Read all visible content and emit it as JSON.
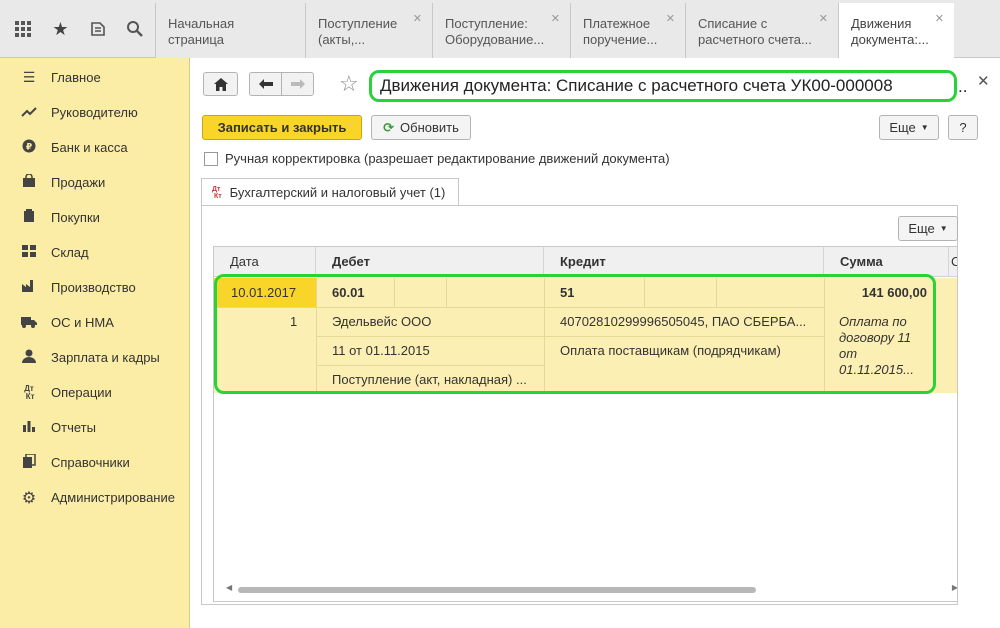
{
  "tabs": [
    {
      "label": "Начальная страница"
    },
    {
      "label": "Поступление (акты,..."
    },
    {
      "label": "Поступление: Оборудование..."
    },
    {
      "label": "Платежное поручение..."
    },
    {
      "label": "Списание с расчетного счета..."
    },
    {
      "label": "Движения документа:..."
    }
  ],
  "sidebar": {
    "items": [
      {
        "label": "Главное",
        "icon": "menu-lines-icon"
      },
      {
        "label": "Руководителю",
        "icon": "trend-chart-icon"
      },
      {
        "label": "Банк и касса",
        "icon": "ruble-coin-icon"
      },
      {
        "label": "Продажи",
        "icon": "shopping-bag-icon"
      },
      {
        "label": "Покупки",
        "icon": "cart-icon"
      },
      {
        "label": "Склад",
        "icon": "warehouse-icon"
      },
      {
        "label": "Производство",
        "icon": "factory-icon"
      },
      {
        "label": "ОС и НМА",
        "icon": "truck-icon"
      },
      {
        "label": "Зарплата и кадры",
        "icon": "person-icon"
      },
      {
        "label": "Операции",
        "icon": "dt-kt-icon"
      },
      {
        "label": "Отчеты",
        "icon": "bar-chart-icon"
      },
      {
        "label": "Справочники",
        "icon": "books-icon"
      },
      {
        "label": "Администрирование",
        "icon": "gear-icon"
      }
    ]
  },
  "doc": {
    "title": "Движения документа: Списание с расчетного счета УК00-000008",
    "title_overflow": "..",
    "save_close_label": "Записать и закрыть",
    "refresh_label": "Обновить",
    "more_label": "Еще",
    "help_label": "?",
    "manual_edit_label": "Ручная корректировка (разрешает редактирование движений документа)",
    "section_tab_label": "Бухгалтерский и налоговый учет (1)",
    "section_tab_icon": "Дт Кт"
  },
  "grid": {
    "more_label": "Еще",
    "headers": {
      "date": "Дата",
      "debit": "Дебет",
      "credit": "Кредит",
      "sum": "Сумма",
      "extra": "С"
    },
    "row": {
      "date": "10.01.2017",
      "num": "1",
      "debit_account": "60.01",
      "debit_sub1": "Эдельвейс ООО",
      "debit_sub2": "11 от 01.11.2015",
      "debit_sub3": "Поступление (акт, накладная) ...",
      "credit_account": "51",
      "credit_sub1": "40702810299996505045, ПАО СБЕРБА...",
      "credit_sub2": "Оплата поставщикам (подрядчикам)",
      "sum": "141 600,00",
      "sum_comment": "Оплата по договору 11 от 01.11.2015..."
    }
  },
  "colors": {
    "accent": "#f9d52a",
    "sidebar": "#fbeca6",
    "highlight": "#28d33a"
  }
}
